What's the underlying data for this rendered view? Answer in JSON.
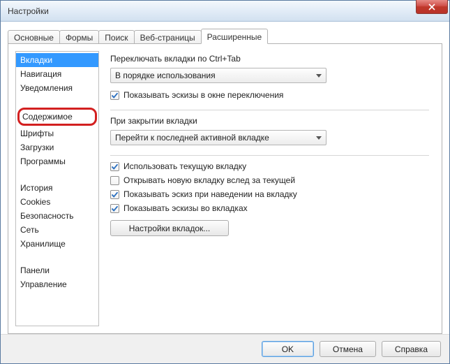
{
  "window": {
    "title": "Настройки"
  },
  "tabs": [
    {
      "label": "Основные"
    },
    {
      "label": "Формы"
    },
    {
      "label": "Поиск"
    },
    {
      "label": "Веб-страницы"
    },
    {
      "label": "Расширенные",
      "active": true
    }
  ],
  "sidebar": {
    "items": [
      "Вкладки",
      "Навигация",
      "Уведомления",
      "Содержимое",
      "Шрифты",
      "Загрузки",
      "Программы",
      "История",
      "Cookies",
      "Безопасность",
      "Сеть",
      "Хранилище",
      "Панели",
      "Управление"
    ]
  },
  "main": {
    "switch_label": "Переключать вкладки по Ctrl+Tab",
    "switch_select": "В порядке использования",
    "show_thumbs": "Показывать эскизы в окне переключения",
    "close_label": "При закрытии вкладки",
    "close_select": "Перейти к последней активной вкладке",
    "use_current": "Использовать текущую вкладку",
    "open_after": "Открывать новую вкладку вслед за текущей",
    "hover_thumb": "Показывать эскиз при наведении на вкладку",
    "tab_thumbs": "Показывать эскизы во вкладках",
    "tab_settings_btn": "Настройки вкладок..."
  },
  "buttons": {
    "ok": "OK",
    "cancel": "Отмена",
    "help": "Справка"
  }
}
